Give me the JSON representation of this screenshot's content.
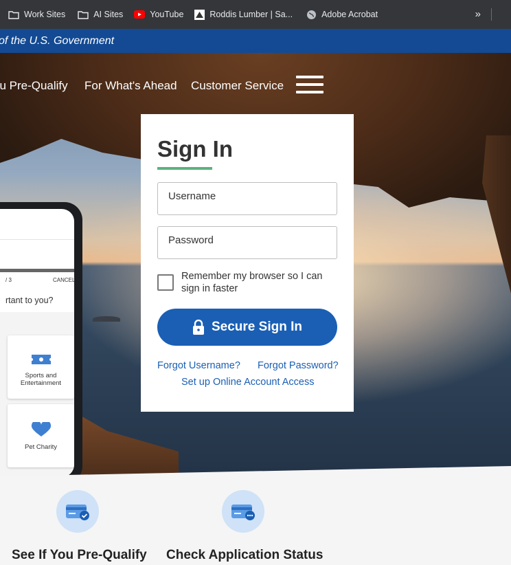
{
  "bookmarks": {
    "items": [
      {
        "label": "Work Sites",
        "icon": "folder-icon"
      },
      {
        "label": "AI Sites",
        "icon": "folder-icon"
      },
      {
        "label": "YouTube",
        "icon": "youtube-icon"
      },
      {
        "label": "Roddis Lumber | Sa...",
        "icon": "site-icon"
      },
      {
        "label": "Adobe Acrobat",
        "icon": "globe-icon"
      }
    ],
    "more": "»"
  },
  "gov_banner": "of the U.S. Government",
  "nav": {
    "items": [
      "ou Pre-Qualify",
      "For What's Ahead",
      "Customer Service"
    ],
    "menu_icon": "hamburger-menu-icon"
  },
  "phone": {
    "steps": "/ 3",
    "cancel": "CANCEL",
    "question": "rtant to you?",
    "cards": [
      "Sports and Entertainment",
      "Pet Charity"
    ]
  },
  "signin": {
    "title": "Sign In",
    "username_placeholder": "Username",
    "password_placeholder": "Password",
    "remember_label": "Remember my browser so I can sign in faster",
    "button_label": "Secure Sign In",
    "forgot_username": "Forgot Username?",
    "forgot_password": "Forgot Password?",
    "setup_access": "Set up Online Account Access"
  },
  "features": [
    {
      "title": "See If You Pre-Qualify",
      "icon": "card-check-icon"
    },
    {
      "title": "Check Application Status",
      "icon": "card-pending-icon"
    }
  ],
  "colors": {
    "accent_blue": "#1a5fb4",
    "gov_blue": "#134a93",
    "underline_green": "#5cb27d"
  }
}
